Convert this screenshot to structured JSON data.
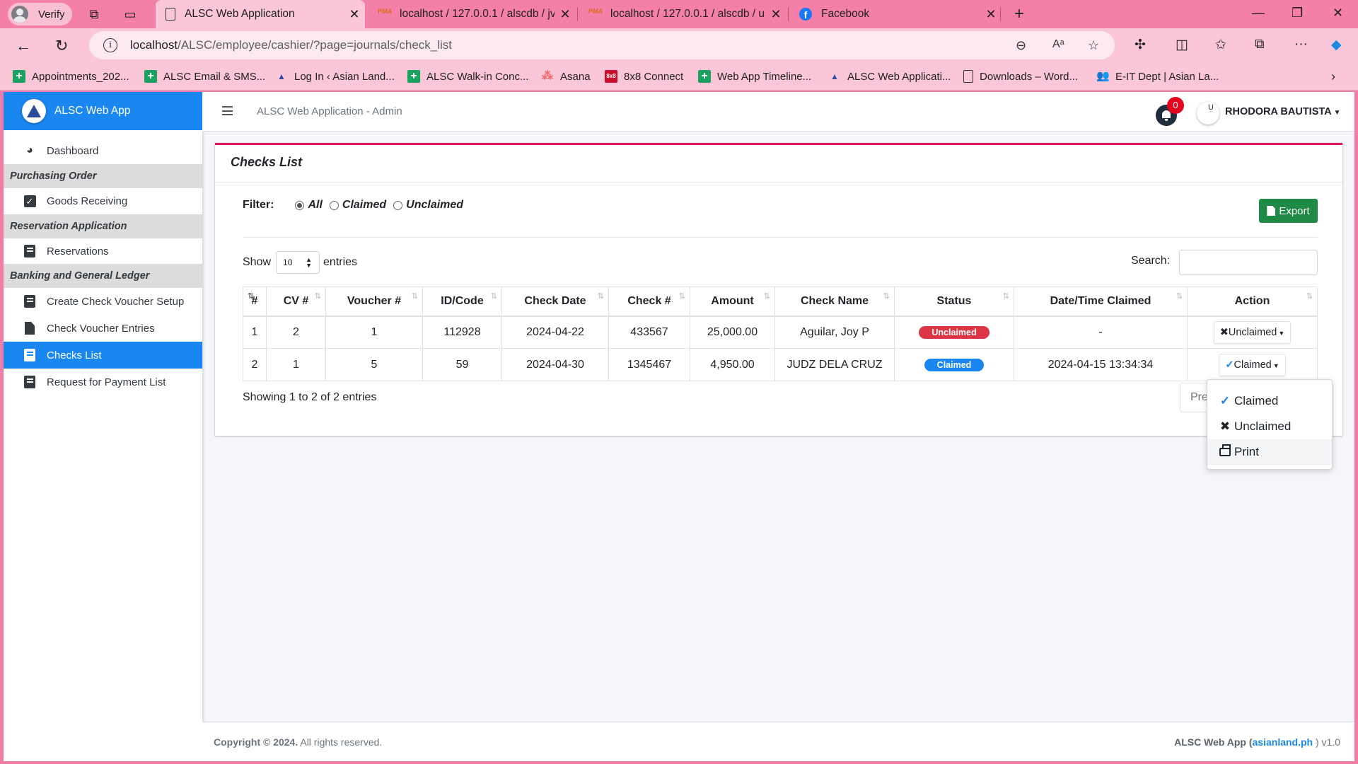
{
  "browser": {
    "profile_label": "Verify",
    "tabs": [
      {
        "title": "ALSC Web Application",
        "icon": "page-icon"
      },
      {
        "title": "localhost / 127.0.0.1 / alscdb / jv",
        "icon": "phpmyadmin-icon"
      },
      {
        "title": "localhost / 127.0.0.1 / alscdb / us",
        "icon": "phpmyadmin-icon"
      },
      {
        "title": "Facebook",
        "icon": "facebook-icon"
      }
    ],
    "pma_label": "PMA",
    "fb_letter": "f",
    "url_host": "localhost",
    "url_path": "/ALSC/employee/cashier/?page=journals/check_list",
    "bookmarks": [
      {
        "label": "Appointments_202...",
        "icon": "google-sheets-icon"
      },
      {
        "label": "ALSC Email & SMS...",
        "icon": "google-sheets-icon"
      },
      {
        "label": "Log In ‹ Asian Land...",
        "icon": "alsc-logo-icon"
      },
      {
        "label": "ALSC Walk-in Conc...",
        "icon": "google-sheets-icon"
      },
      {
        "label": "Asana",
        "icon": "asana-icon"
      },
      {
        "label": "8x8 Connect",
        "icon": "8x8-icon"
      },
      {
        "label": "Web App Timeline...",
        "icon": "google-sheets-icon"
      },
      {
        "label": "ALSC Web Applicati...",
        "icon": "alsc-logo-icon"
      },
      {
        "label": "Downloads – Word...",
        "icon": "document-icon"
      },
      {
        "label": "E-IT Dept | Asian La...",
        "icon": "teams-icon"
      }
    ],
    "x8_text": "8x8"
  },
  "app": {
    "brand": "ALSC Web App",
    "header_title": "ALSC Web Application - Admin",
    "notification_count": "0",
    "avatar_letter": "U",
    "user_name": "RHODORA BAUTISTA"
  },
  "sidebar": {
    "dashboard": "Dashboard",
    "sections": {
      "purchasing": "Purchasing Order",
      "reservation": "Reservation Application",
      "banking": "Banking and General Ledger"
    },
    "items": {
      "goods_receiving": "Goods Receiving",
      "reservations": "Reservations",
      "create_check_voucher": "Create Check Voucher Setup",
      "check_voucher_entries": "Check Voucher Entries",
      "checks_list": "Checks List",
      "request_payment": "Request for Payment List"
    }
  },
  "page": {
    "card_title": "Checks List",
    "filter_label": "Filter:",
    "filter_options": [
      "All",
      "Claimed",
      "Unclaimed"
    ],
    "filter_selected": "All",
    "export_label": "Export",
    "show_label": "Show",
    "entries_value": "10",
    "entries_label": "entries",
    "search_label": "Search:",
    "search_value": "",
    "columns": [
      "#",
      "CV #",
      "Voucher #",
      "ID/Code",
      "Check Date",
      "Check #",
      "Amount",
      "Check Name",
      "Status",
      "Date/Time Claimed",
      "Action"
    ],
    "rows": [
      {
        "no": "1",
        "cv": "2",
        "voucher": "1",
        "id_code": "112928",
        "check_date": "2024-04-22",
        "check_no": "433567",
        "amount": "25,000.00",
        "check_name": "Aguilar, Joy P",
        "status": "Unclaimed",
        "claimed_at": "-",
        "action": "Unclaimed"
      },
      {
        "no": "2",
        "cv": "1",
        "voucher": "5",
        "id_code": "59",
        "check_date": "2024-04-30",
        "check_no": "1345467",
        "amount": "4,950.00",
        "check_name": "JUDZ DELA CRUZ",
        "status": "Claimed",
        "claimed_at": "2024-04-15 13:34:34",
        "action": "Claimed"
      }
    ],
    "showing_text": "Showing 1 to 2 of 2 entries",
    "prev_label": "Prev",
    "dropdown": [
      "Claimed",
      "Unclaimed",
      "Print"
    ]
  },
  "footer": {
    "copyright": "Copyright © 2024.",
    "rights": " All rights reserved.",
    "app_label": "ALSC Web App (",
    "link": "asianland.ph",
    "version": " ) v1.0"
  },
  "colors": {
    "primary": "#1a86f0",
    "danger": "#dc3545",
    "success": "#1e8a45",
    "accent": "#d81b60",
    "chrome": "#f47fa8"
  }
}
